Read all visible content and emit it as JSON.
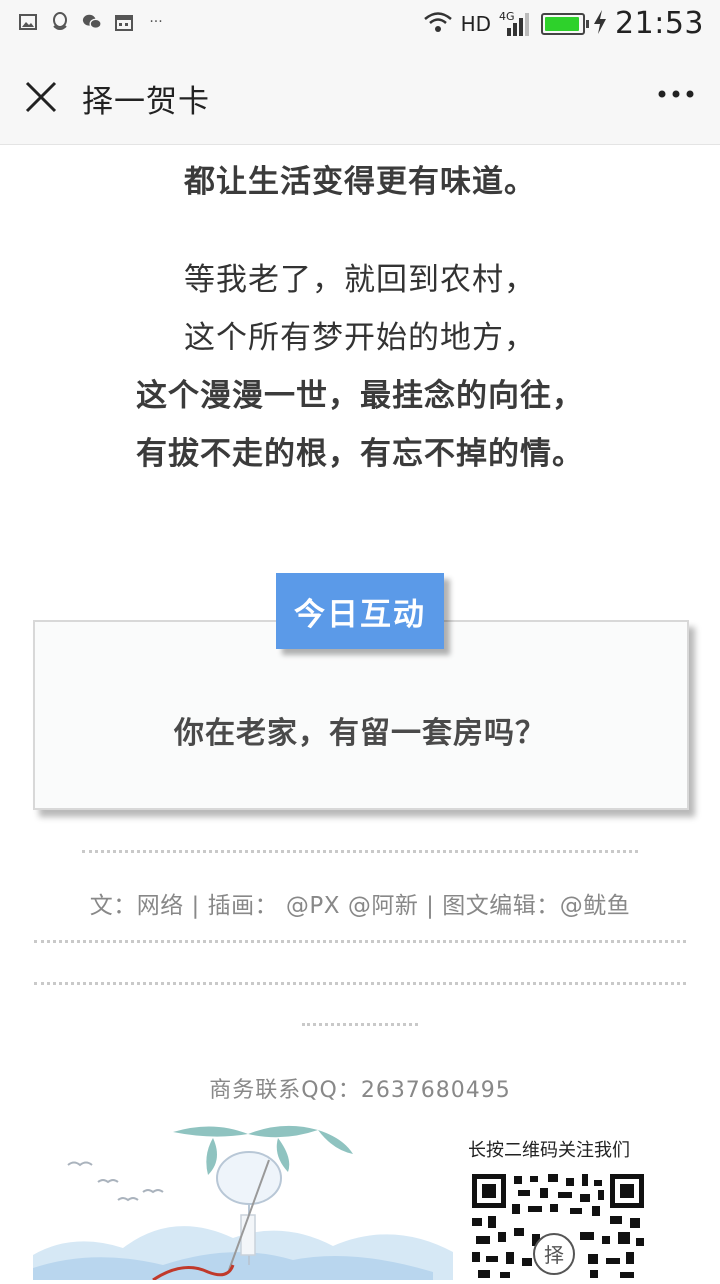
{
  "status_bar": {
    "network": "HD",
    "signal": "4G",
    "time": "21:53",
    "left_icons": [
      "image-icon",
      "qq-icon",
      "wechat-icon",
      "calendar-icon",
      "more-notifications-icon"
    ]
  },
  "nav": {
    "title": "择一贺卡"
  },
  "article": {
    "lines": [
      {
        "text": "都让生活变得更有味道。",
        "bold": true
      },
      {
        "text": "等我老了，就回到农村，",
        "bold": false
      },
      {
        "text": "这个所有梦开始的地方，",
        "bold": false
      },
      {
        "text": "这个漫漫一世，最挂念的向往，",
        "bold": true
      },
      {
        "text": "有拔不走的根，有忘不掉的情。",
        "bold": true
      }
    ]
  },
  "interaction": {
    "badge": "今日互动",
    "question": "你在老家，有留一套房吗？"
  },
  "credits": "文：网络  | 插画： @PX @阿新 | 图文编辑：@鱿鱼",
  "contact": "商务联系QQ：2637680495",
  "footer": {
    "qr_label": "长按二维码关注我们"
  },
  "colors": {
    "badge_bg": "#5b9ae8",
    "battery": "#2ed12b"
  }
}
